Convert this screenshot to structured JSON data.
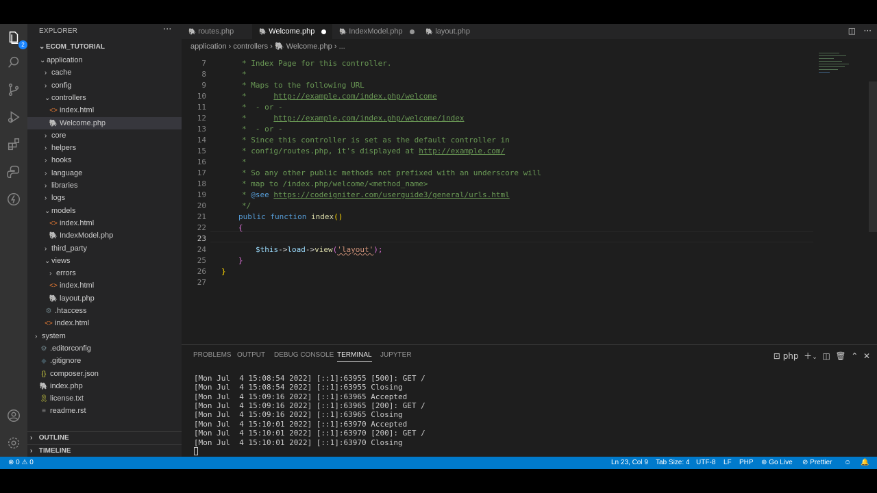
{
  "explorer": {
    "title": "EXPLORER",
    "more": "···",
    "root": "ECOM_TUTORIAL",
    "badge": "2",
    "items": [
      {
        "label": "application",
        "chev": "⌄",
        "icon": ""
      },
      {
        "label": "cache",
        "chev": "›",
        "icon": ""
      },
      {
        "label": "config",
        "chev": "›",
        "icon": ""
      },
      {
        "label": "controllers",
        "chev": "⌄",
        "icon": ""
      },
      {
        "label": "index.html",
        "chev": "",
        "icon": "<>"
      },
      {
        "label": "Welcome.php",
        "chev": "",
        "icon": "php"
      },
      {
        "label": "core",
        "chev": "›",
        "icon": ""
      },
      {
        "label": "helpers",
        "chev": "›",
        "icon": ""
      },
      {
        "label": "hooks",
        "chev": "›",
        "icon": ""
      },
      {
        "label": "language",
        "chev": "›",
        "icon": ""
      },
      {
        "label": "libraries",
        "chev": "›",
        "icon": ""
      },
      {
        "label": "logs",
        "chev": "›",
        "icon": ""
      },
      {
        "label": "models",
        "chev": "⌄",
        "icon": ""
      },
      {
        "label": "index.html",
        "chev": "",
        "icon": "<>"
      },
      {
        "label": "IndexModel.php",
        "chev": "",
        "icon": "php"
      },
      {
        "label": "third_party",
        "chev": "›",
        "icon": ""
      },
      {
        "label": "views",
        "chev": "⌄",
        "icon": ""
      },
      {
        "label": "errors",
        "chev": "›",
        "icon": ""
      },
      {
        "label": "index.html",
        "chev": "",
        "icon": "<>"
      },
      {
        "label": "layout.php",
        "chev": "",
        "icon": "php"
      },
      {
        "label": ".htaccess",
        "chev": "",
        "icon": "⚙"
      },
      {
        "label": "index.html",
        "chev": "",
        "icon": "<>"
      },
      {
        "label": "system",
        "chev": "›",
        "icon": ""
      },
      {
        "label": ".editorconfig",
        "chev": "",
        "icon": "⚙"
      },
      {
        "label": ".gitignore",
        "chev": "",
        "icon": "◆"
      },
      {
        "label": "composer.json",
        "chev": "",
        "icon": "{}"
      },
      {
        "label": "index.php",
        "chev": "",
        "icon": "php"
      },
      {
        "label": "license.txt",
        "chev": "",
        "icon": "🎗"
      },
      {
        "label": "readme.rst",
        "chev": "",
        "icon": "≡"
      }
    ],
    "outline": "OUTLINE",
    "timeline": "TIMELINE"
  },
  "tabs": [
    {
      "label": "routes.php"
    },
    {
      "label": "Welcome.php"
    },
    {
      "label": "IndexModel.php"
    },
    {
      "label": "layout.php"
    }
  ],
  "breadcrumb": {
    "p1": "application",
    "p2": "controllers",
    "p3": "Welcome.php",
    "p4": "..."
  },
  "code": {
    "l7": "* Index Page for this controller.",
    "l8": "*",
    "l9": "* Maps to the following URL",
    "l10a": "*      ",
    "l10b": "http://example.com/index.php/welcome",
    "l11": "*  - or -",
    "l12a": "*      ",
    "l12b": "http://example.com/index.php/welcome/index",
    "l13": "*  - or -",
    "l14": "* Since this controller is set as the default controller in",
    "l15a": "* config/routes.php, it's displayed at ",
    "l15b": "http://example.com/",
    "l16": "*",
    "l17": "* So any other public methods not prefixed with an underscore will",
    "l18": "* map to /index.php/welcome/<method_name>",
    "l19a": "* ",
    "l19tag": "@see",
    "l19b": " ",
    "l19url": "https://codeigniter.com/userguide3/general/urls.html",
    "l20": "*/",
    "l21kw": "public function ",
    "l21fn": "index",
    "l21p": "()",
    "l22": "{",
    "l24var": "$this",
    "l24a": "->",
    "l24load": "load",
    "l24b": "->",
    "l24view": "view",
    "l24c": "(",
    "l24str": "'layout'",
    "l24d": ");",
    "l25": "}",
    "l26": "}",
    "line_numbers": [
      "7",
      "8",
      "9",
      "10",
      "11",
      "12",
      "13",
      "14",
      "15",
      "16",
      "17",
      "18",
      "19",
      "20",
      "21",
      "22",
      "23",
      "24",
      "25",
      "26",
      "27"
    ]
  },
  "panel": {
    "tabs": [
      "PROBLEMS",
      "OUTPUT",
      "DEBUG CONSOLE",
      "TERMINAL",
      "JUPYTER"
    ],
    "shell": "php",
    "lines": [
      "[Mon Jul  4 15:08:54 2022] [::1]:63955 [500]: GET /",
      "[Mon Jul  4 15:08:54 2022] [::1]:63955 Closing",
      "[Mon Jul  4 15:09:16 2022] [::1]:63965 Accepted",
      "[Mon Jul  4 15:09:16 2022] [::1]:63965 [200]: GET /",
      "[Mon Jul  4 15:09:16 2022] [::1]:63965 Closing",
      "[Mon Jul  4 15:10:01 2022] [::1]:63970 Accepted",
      "[Mon Jul  4 15:10:01 2022] [::1]:63970 [200]: GET /",
      "[Mon Jul  4 15:10:01 2022] [::1]:63970 Closing"
    ]
  },
  "status": {
    "errors": "0",
    "warnings": "0",
    "position": "Ln 23, Col 9",
    "tabsize": "Tab Size: 4",
    "encoding": "UTF-8",
    "eol": "LF",
    "language": "PHP",
    "golive": "Go Live",
    "prettier": "Prettier"
  }
}
